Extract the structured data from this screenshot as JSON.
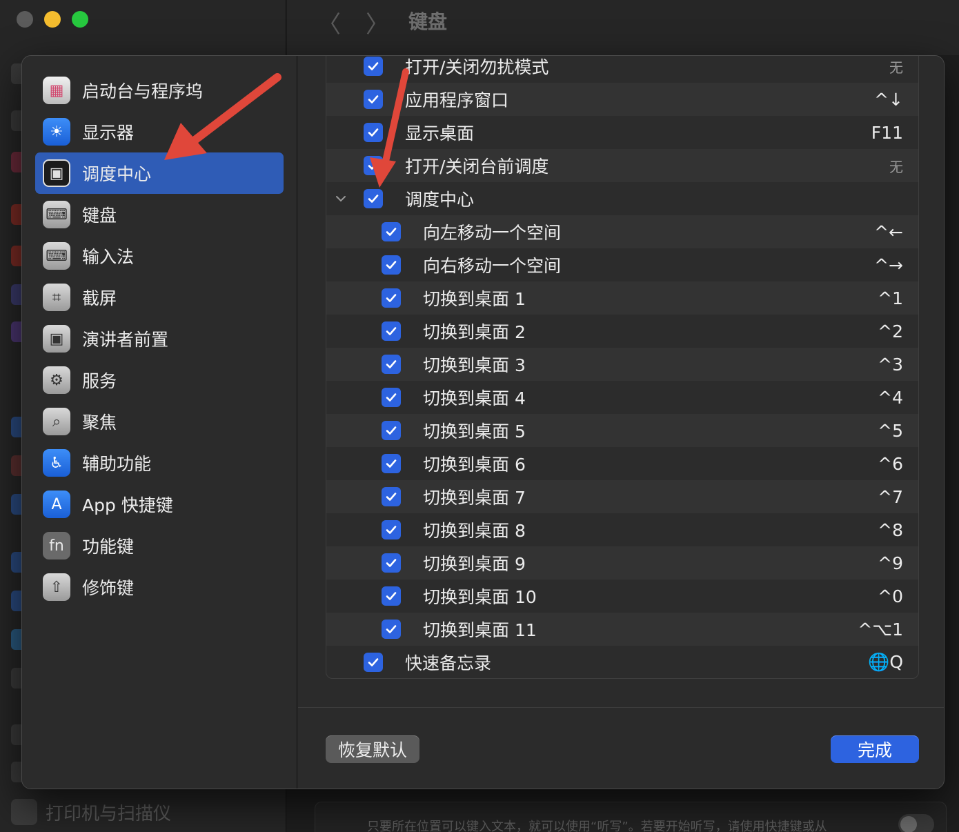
{
  "window": {
    "title": "键盘",
    "back_glyph": "〈",
    "forward_glyph": "〉"
  },
  "colors": {
    "accent": "#2d63e0",
    "selected_sidebar": "#2f5cb6",
    "annotation_arrow": "#e0473a",
    "traffic_red": "#5b5b5b",
    "traffic_yellow": "#f5bd2f",
    "traffic_green": "#27c93f"
  },
  "background": {
    "bottom_item_label": "打印机与扫描仪",
    "hint_text": "只要所在位置可以键入文本，就可以使用“听写”。若要开始听写，请使用快捷键或从"
  },
  "sidebar": {
    "items": [
      {
        "label": "启动台与程序坞",
        "icon": "launchpad-icon",
        "glyph": "▦"
      },
      {
        "label": "显示器",
        "icon": "display-brightness-icon",
        "glyph": "☀"
      },
      {
        "label": "调度中心",
        "icon": "mission-control-icon",
        "glyph": "▣",
        "selected": true
      },
      {
        "label": "键盘",
        "icon": "keyboard-icon",
        "glyph": "⌨"
      },
      {
        "label": "输入法",
        "icon": "input-method-icon",
        "glyph": "⌨"
      },
      {
        "label": "截屏",
        "icon": "screenshot-icon",
        "glyph": "⌗"
      },
      {
        "label": "演讲者前置",
        "icon": "presenter-icon",
        "glyph": "▣"
      },
      {
        "label": "服务",
        "icon": "services-gear-icon",
        "glyph": "⚙"
      },
      {
        "label": "聚焦",
        "icon": "spotlight-search-icon",
        "glyph": "⌕"
      },
      {
        "label": "辅助功能",
        "icon": "accessibility-icon",
        "glyph": "♿"
      },
      {
        "label": "App 快捷键",
        "icon": "app-store-icon",
        "glyph": "A"
      },
      {
        "label": "功能键",
        "icon": "fn-key-icon",
        "glyph": "fn"
      },
      {
        "label": "修饰键",
        "icon": "modifier-key-icon",
        "glyph": "⇧"
      }
    ]
  },
  "shortcuts": {
    "rows": [
      {
        "label": "打开/关闭勿扰模式",
        "shortcut": "无",
        "checked": true,
        "indent": 0
      },
      {
        "label": "应用程序窗口",
        "shortcut": "^↓",
        "checked": true,
        "indent": 0
      },
      {
        "label": "显示桌面",
        "shortcut": "F11",
        "checked": true,
        "indent": 0
      },
      {
        "label": "打开/关闭台前调度",
        "shortcut": "无",
        "checked": true,
        "indent": 0
      },
      {
        "label": "调度中心",
        "shortcut": "",
        "checked": true,
        "indent": 0,
        "group": true
      },
      {
        "label": "向左移动一个空间",
        "shortcut": "^←",
        "checked": true,
        "indent": 1
      },
      {
        "label": "向右移动一个空间",
        "shortcut": "^→",
        "checked": true,
        "indent": 1
      },
      {
        "label": "切换到桌面 1",
        "shortcut": "^1",
        "checked": true,
        "indent": 1
      },
      {
        "label": "切换到桌面 2",
        "shortcut": "^2",
        "checked": true,
        "indent": 1
      },
      {
        "label": "切换到桌面 3",
        "shortcut": "^3",
        "checked": true,
        "indent": 1
      },
      {
        "label": "切换到桌面 4",
        "shortcut": "^4",
        "checked": true,
        "indent": 1
      },
      {
        "label": "切换到桌面 5",
        "shortcut": "^5",
        "checked": true,
        "indent": 1
      },
      {
        "label": "切换到桌面 6",
        "shortcut": "^6",
        "checked": true,
        "indent": 1
      },
      {
        "label": "切换到桌面 7",
        "shortcut": "^7",
        "checked": true,
        "indent": 1
      },
      {
        "label": "切换到桌面 8",
        "shortcut": "^8",
        "checked": true,
        "indent": 1
      },
      {
        "label": "切换到桌面 9",
        "shortcut": "^9",
        "checked": true,
        "indent": 1
      },
      {
        "label": "切换到桌面 10",
        "shortcut": "^0",
        "checked": true,
        "indent": 1
      },
      {
        "label": "切换到桌面 11",
        "shortcut": "^⌥1",
        "checked": true,
        "indent": 1
      },
      {
        "label": "快速备忘录",
        "shortcut": "🌐Q",
        "checked": true,
        "indent": 0
      }
    ]
  },
  "footer": {
    "reset_label": "恢复默认",
    "done_label": "完成"
  }
}
